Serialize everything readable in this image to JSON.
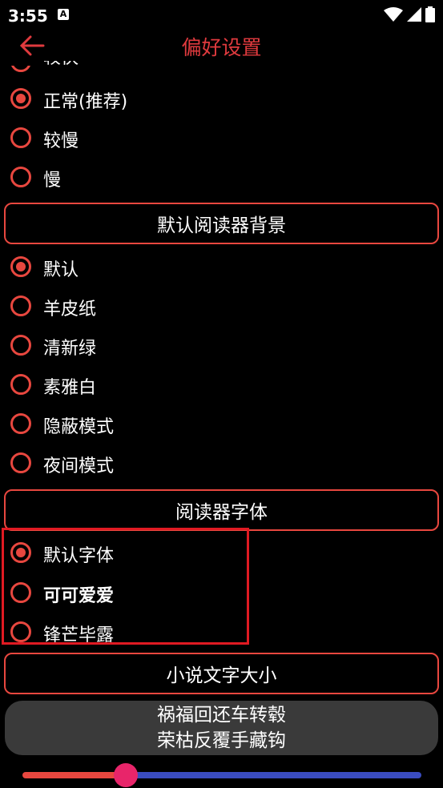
{
  "status": {
    "time": "3:55",
    "app_icon_letter": "A"
  },
  "appbar": {
    "title": "偏好设置",
    "back_icon": "arrow-left-icon"
  },
  "speed_options": [
    {
      "label": "较快",
      "checked": false
    },
    {
      "label": "正常(推荐)",
      "checked": true
    },
    {
      "label": "较慢",
      "checked": false
    },
    {
      "label": "慢",
      "checked": false
    }
  ],
  "background_section": {
    "label": "默认阅读器背景"
  },
  "background_options": [
    {
      "label": "默认",
      "checked": true
    },
    {
      "label": "羊皮纸",
      "checked": false
    },
    {
      "label": "清新绿",
      "checked": false
    },
    {
      "label": "素雅白",
      "checked": false
    },
    {
      "label": "隐蔽模式",
      "checked": false
    },
    {
      "label": "夜间模式",
      "checked": false
    }
  ],
  "font_section": {
    "label": "阅读器字体"
  },
  "font_options": [
    {
      "label": "默认字体",
      "checked": true
    },
    {
      "label": "可可爱爱",
      "checked": false
    },
    {
      "label": "锋芒毕露",
      "checked": false
    }
  ],
  "size_section": {
    "label": "小说文字大小"
  },
  "preview": {
    "line1": "祸福回还车转毂",
    "line2": "荣枯反覆手藏钩"
  },
  "slider": {
    "value_fraction": 0.26
  },
  "colors": {
    "accent": "#e8473f",
    "title": "#e03a3e",
    "slider_active": "#e8473f",
    "slider_inactive": "#3a4cc0",
    "thumb": "#e8256a"
  }
}
